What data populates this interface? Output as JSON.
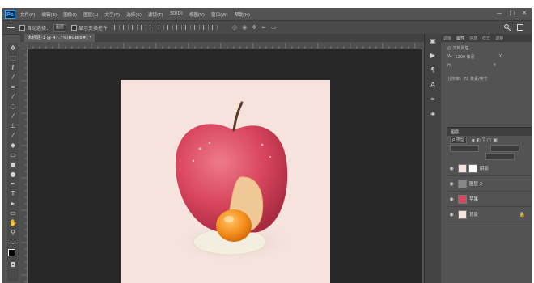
{
  "app": {
    "logo": "Ps"
  },
  "menu": [
    "文件(F)",
    "编辑(E)",
    "图像(I)",
    "图层(L)",
    "文字(Y)",
    "选择(S)",
    "滤镜(T)",
    "3D(D)",
    "视图(V)",
    "窗口(W)",
    "帮助(H)"
  ],
  "window_controls": {
    "minimize": "—",
    "maximize": "□",
    "close": "✕"
  },
  "options_bar": {
    "auto_select_label": "自动选择：",
    "auto_select_value": "图层",
    "show_transform_label": "显示变换控件"
  },
  "document_tab": {
    "title": "未标题-1 @ 47.7%(RGB/8#) *"
  },
  "tools": [
    "move-icon",
    "marquee-icon",
    "lasso-icon",
    "magic-wand-icon",
    "crop-icon",
    "eyedropper-icon",
    "healing-icon",
    "brush-icon",
    "stamp-icon",
    "history-brush-icon",
    "eraser-icon",
    "gradient-icon",
    "blur-icon",
    "dodge-icon",
    "pen-icon",
    "type-icon",
    "path-select-icon",
    "shape-icon",
    "hand-icon",
    "zoom-icon"
  ],
  "properties_panel": {
    "tabs": [
      "调板",
      "属性",
      "信息",
      "样式",
      "调整"
    ],
    "active_tab": "属性",
    "section": "文档属性",
    "width_label": "W:",
    "width_value": "1200 像素",
    "x_label": "X:",
    "height_label": "H:",
    "height_value": "",
    "y_label": "Y:",
    "resolution": "分辨率：72 像素/英寸"
  },
  "layers_panel": {
    "title": "图层",
    "filter": "ρ 类型",
    "layers": [
      {
        "name": "阴影",
        "visible": true,
        "has_mask": true
      },
      {
        "name": "图层 2",
        "visible": true,
        "has_mask": false
      },
      {
        "name": "苹果",
        "visible": true,
        "has_mask": false
      },
      {
        "name": "背景",
        "visible": true,
        "has_mask": false,
        "locked": true
      }
    ]
  },
  "colors": {
    "background_layer": "#f6e3de",
    "apple": "#d9465e",
    "yolk": "#f5921e",
    "chrome": "#535353"
  }
}
